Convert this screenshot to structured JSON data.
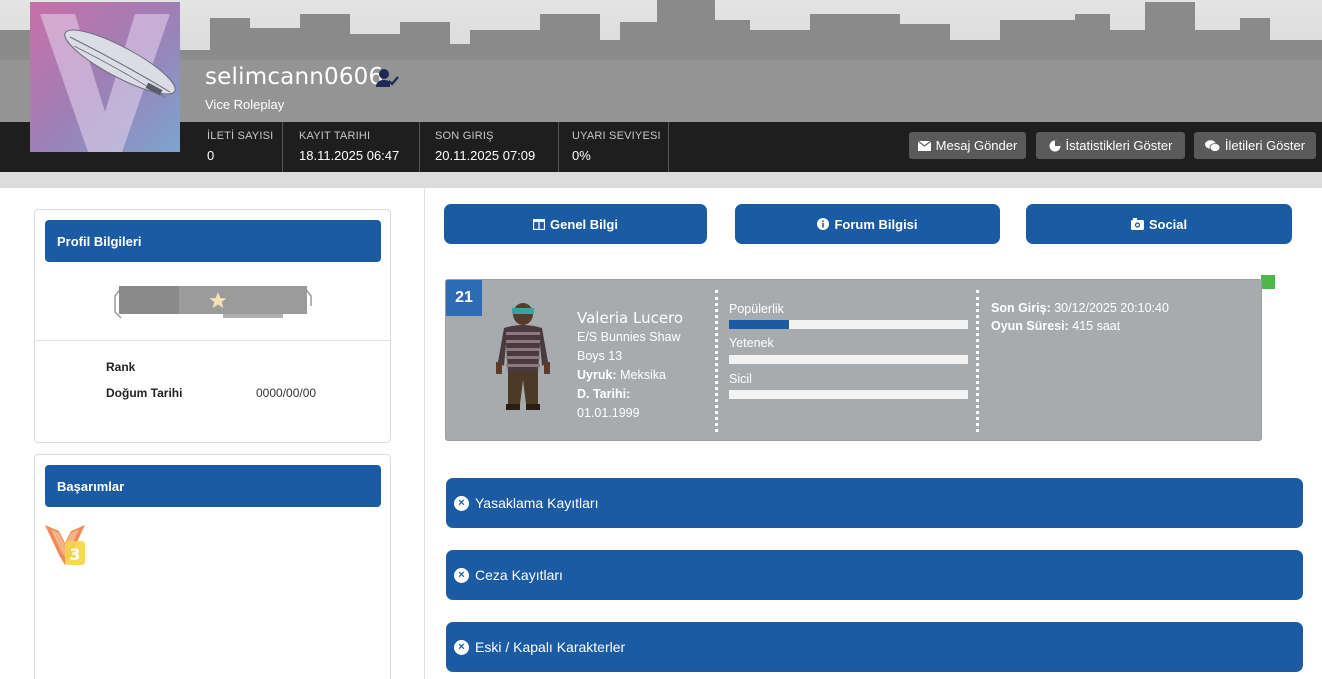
{
  "profile": {
    "username": "selimcann0606",
    "server": "Vice Roleplay"
  },
  "stats": [
    {
      "label": "İLETİ SAYISI",
      "value": "0"
    },
    {
      "label": "KAYIT TARIHI",
      "value": "18.11.2025 06:47"
    },
    {
      "label": "SON GIRIŞ",
      "value": "20.11.2025 07:09"
    },
    {
      "label": "UYARI SEVIYESI",
      "value": "0%"
    }
  ],
  "header_buttons": {
    "message": "Mesaj Gönder",
    "statistics": "İstatistikleri Göster",
    "posts": "İletileri Göster"
  },
  "profile_info": {
    "title": "Profil Bilgileri",
    "rank_label": "Rank",
    "birth_label": "Doğum Tarihi",
    "birth_value": "0000/00/00"
  },
  "achievements": {
    "title": "Başarımlar",
    "badge_text": "3"
  },
  "tabs": {
    "general": "Genel Bilgi",
    "forum": "Forum Bilgisi",
    "social": "Social"
  },
  "character": {
    "id": "21",
    "name": "Valeria Lucero",
    "line1": "E/S Bunnies Shaw",
    "line2": "Boys 13",
    "nationality_label": "Uyruk:",
    "nationality_value": "Meksika",
    "birth_label": "D. Tarihi:",
    "birth_value": "01.01.1999",
    "bars": [
      {
        "label": "Popülerlik",
        "fill_percent": 25
      },
      {
        "label": "Yetenek",
        "fill_percent": 0
      },
      {
        "label": "Sicil",
        "fill_percent": 0
      }
    ],
    "last_login_label": "Son Giriş:",
    "last_login_value": "30/12/2025 20:10:40",
    "play_time_label": "Oyun Süresi:",
    "play_time_value": "415 saat",
    "status_color": "#4cb84c"
  },
  "sections": {
    "bans": "Yasaklama Kayıtları",
    "penalties": "Ceza Kayıtları",
    "old_characters": "Eski / Kapalı Karakterler"
  },
  "colors": {
    "primary": "#1a5ba3",
    "stats_bar": "#1e1e1e",
    "button_grey": "#5a5a5a",
    "card_grey": "#a7abae"
  }
}
